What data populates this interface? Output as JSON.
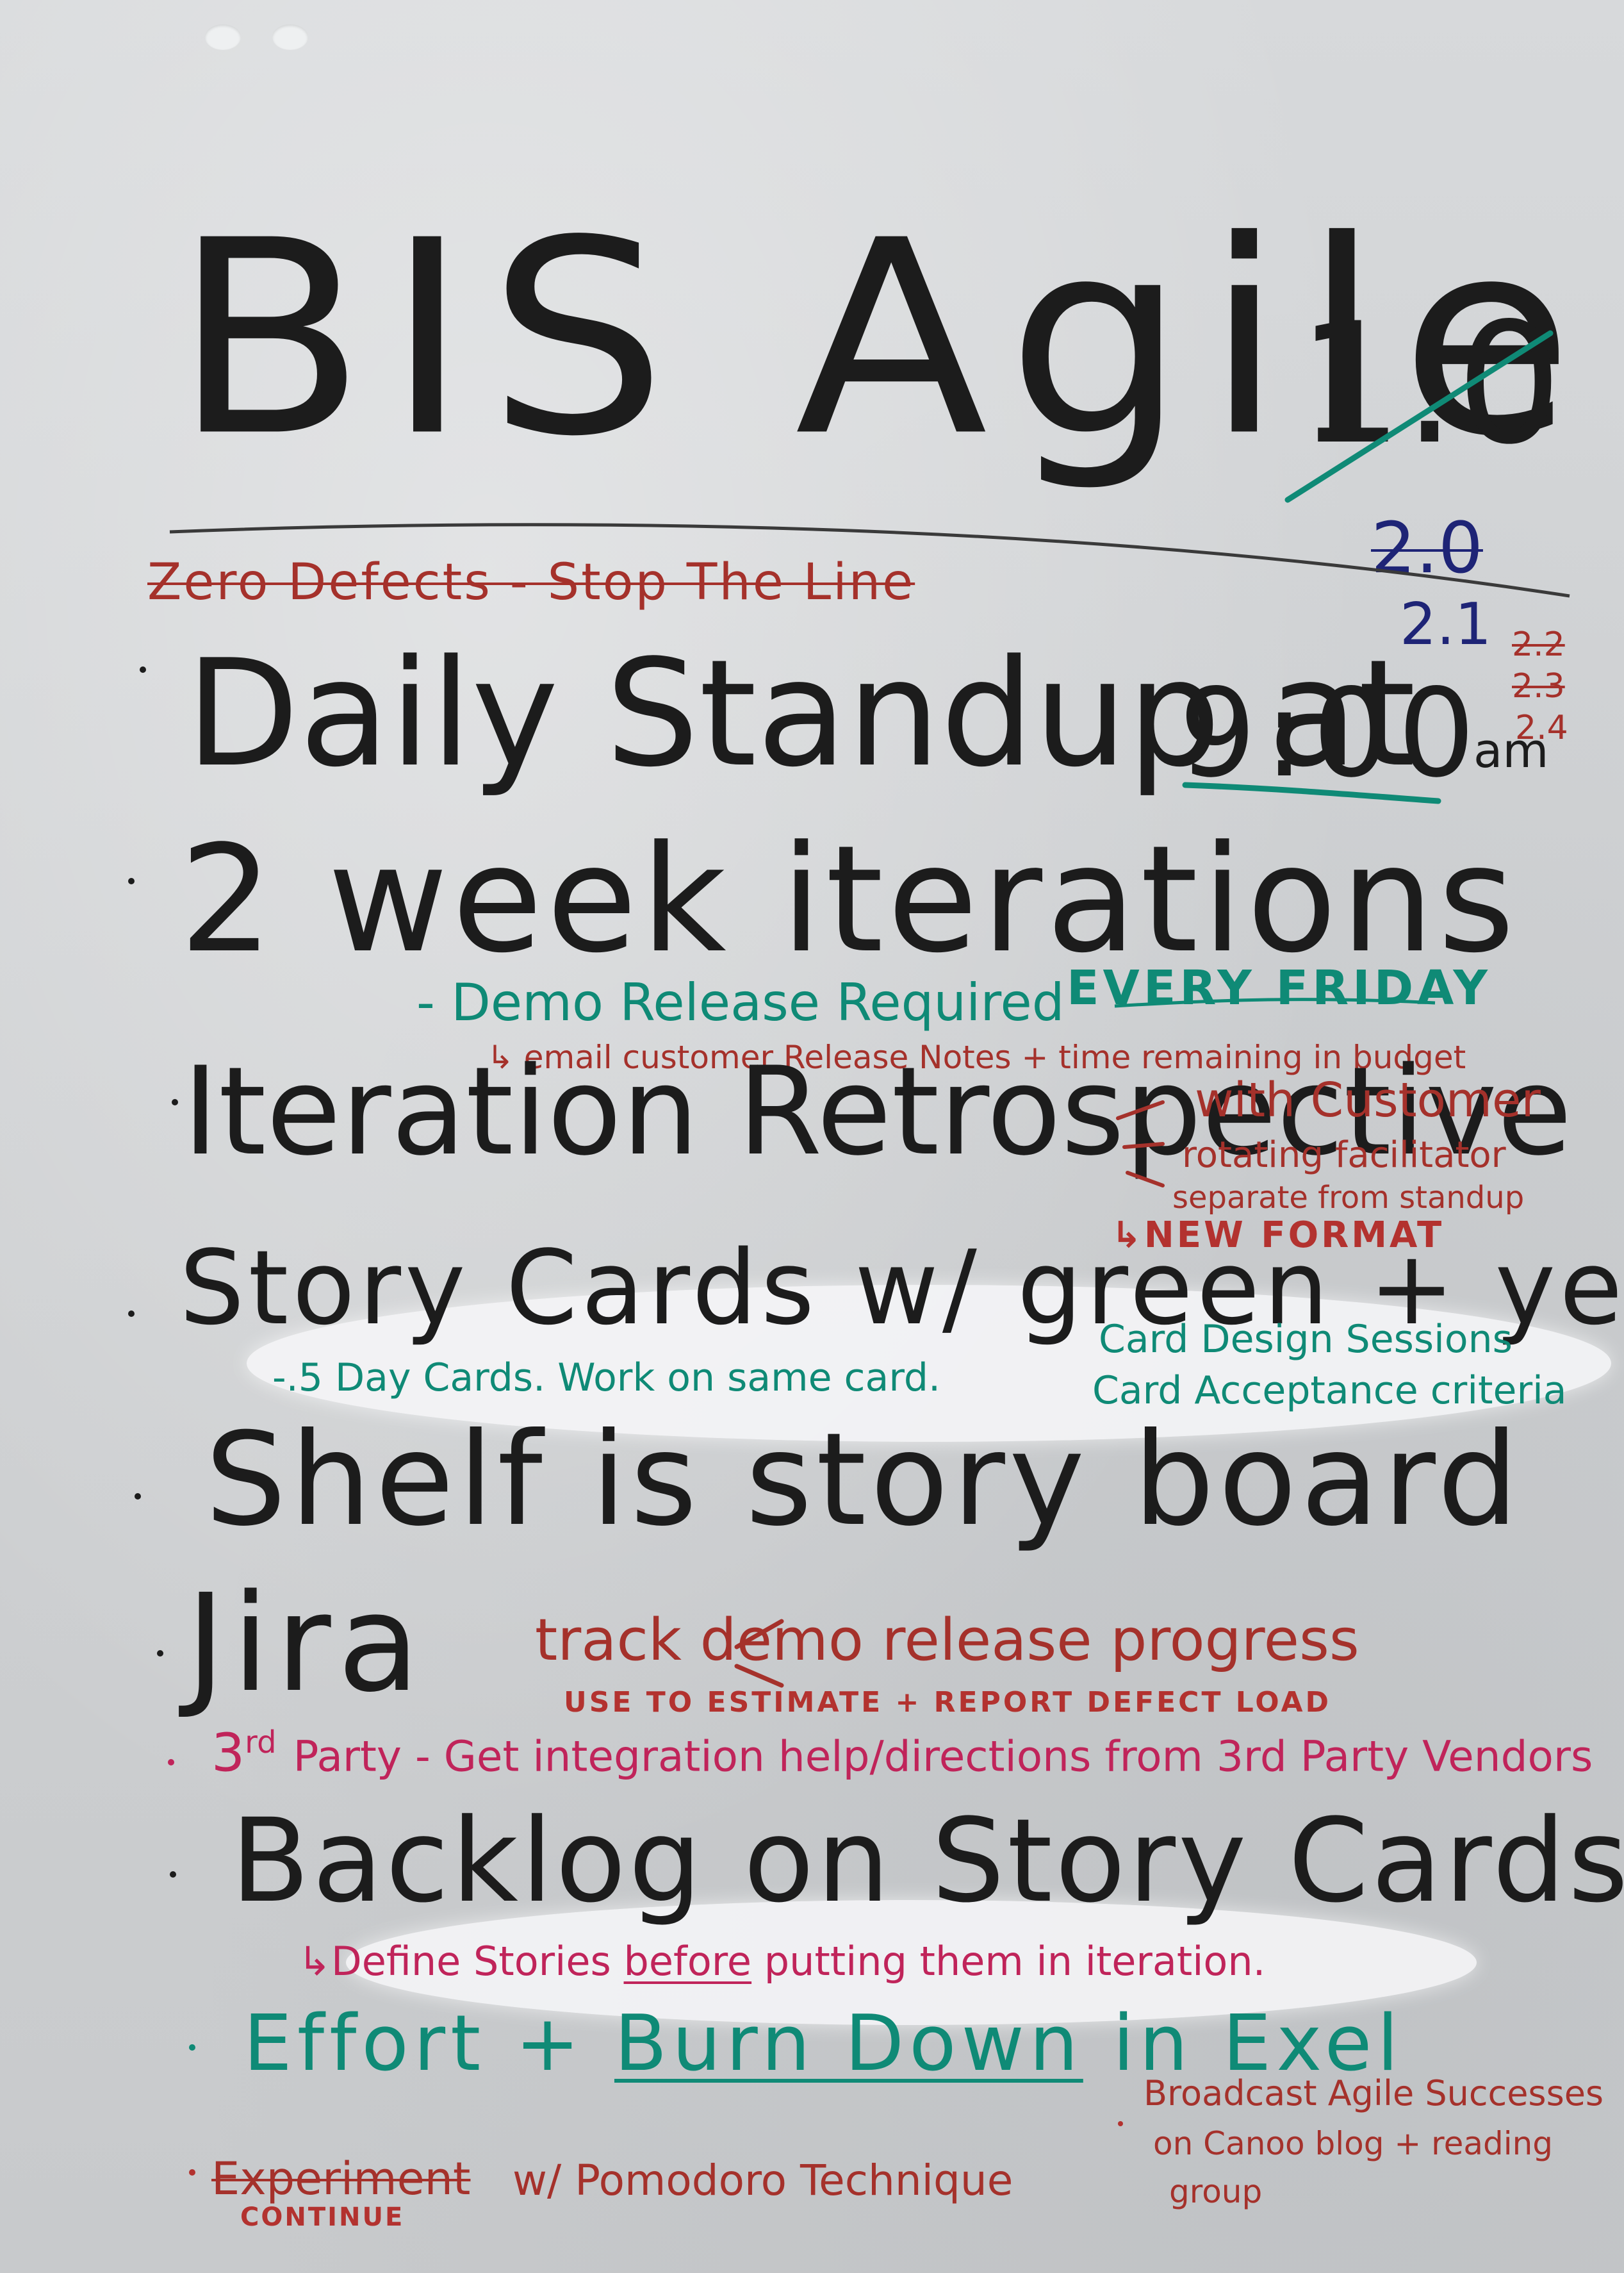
{
  "title": {
    "main": "BIS Agile",
    "old_version": "1.0",
    "versions": [
      "2.0",
      "2.1",
      "2.2",
      "2.3",
      "2.4"
    ]
  },
  "crossed_out_motto": "Zero Defects - Stop The Line",
  "items": {
    "standup": {
      "text": "Daily Standup at",
      "time": "9:00",
      "suffix": "am"
    },
    "iterations": {
      "text": "2 week iterations",
      "note": "- Demo Release Required",
      "note_emphasis": "EVERY FRIDAY",
      "subnote": "email customer Release Notes + time remaining in budget"
    },
    "retro": {
      "text": "Iteration Retrospective",
      "notes": [
        "with Customer",
        "rotating facilitator",
        "separate from standup"
      ],
      "arrow_note": "NEW FORMAT"
    },
    "story_cards": {
      "text": "Story Cards w/ green + yellow",
      "note1": "-.5 Day Cards. Work on same card.",
      "note2": "Card Design Sessions",
      "note3": "Card Acceptance criteria"
    },
    "shelf": {
      "text": "Shelf is story board"
    },
    "jira": {
      "text": "Jira",
      "note1": "track demo release progress",
      "note2": "USE TO ESTIMATE + REPORT DEFECT LOAD"
    },
    "third_party": {
      "prefix": "3",
      "ordinal": "rd",
      "text": "Party - Get integration help/directions from 3rd Party Vendors"
    },
    "backlog": {
      "text": "Backlog on Story Cards",
      "note_start": "Define Stories",
      "note_emphasis": "before",
      "note_end": "putting them in iteration."
    },
    "effort": {
      "start": "Effort +",
      "emphasis": "Burn Down",
      "end": "in Exel"
    },
    "experiment": {
      "struck": "Experiment",
      "text": "w/ Pomodoro Technique",
      "replacement": "CONTINUE"
    },
    "broadcast": {
      "line1": "Broadcast Agile Successes",
      "line2": "on Canoo blog + reading",
      "line3": "group"
    }
  },
  "colors": {
    "paper": "#d3d5d7",
    "black_marker": "#1c1c1c",
    "red_marker": "#a5312b",
    "magenta_marker": "#c0245a",
    "teal_marker": "#0f8a76",
    "navy_marker": "#1e2476"
  }
}
